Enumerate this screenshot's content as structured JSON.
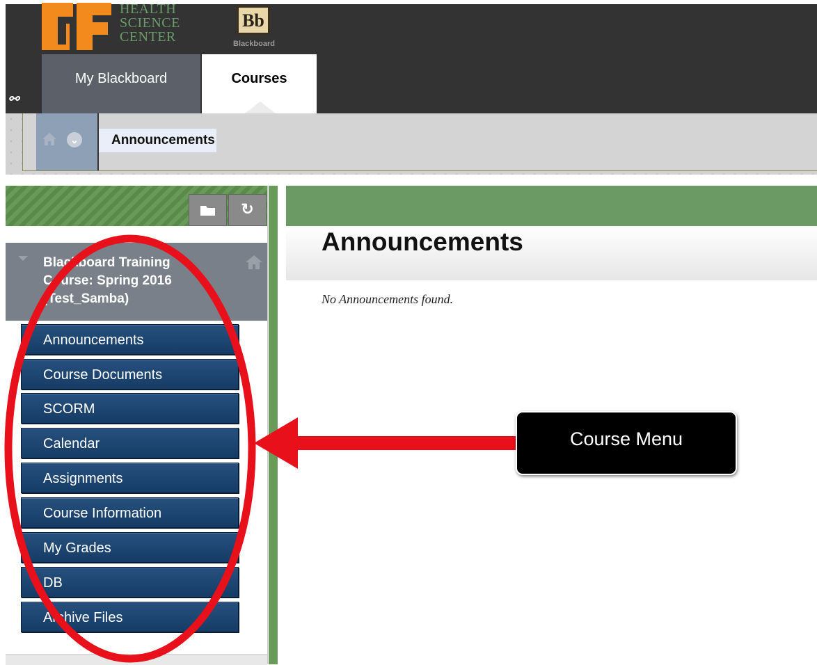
{
  "header": {
    "institution_lines": [
      "HEALTH",
      "SCIENCE",
      "CENTER"
    ],
    "bb_logo_text": "Bb",
    "bb_caption": "Blackboard",
    "tabs": [
      {
        "label": "My Blackboard",
        "active": false
      },
      {
        "label": "Courses",
        "active": true
      }
    ]
  },
  "breadcrumb": {
    "current": "Announcements"
  },
  "course_menu": {
    "course_title": "Blackboard Training Course: Spring 2016 (Test_Samba)",
    "items": [
      {
        "label": "Announcements"
      },
      {
        "label": "Course Documents"
      },
      {
        "label": "SCORM"
      },
      {
        "label": "Calendar"
      },
      {
        "label": "Assignments"
      },
      {
        "label": "Course Information"
      },
      {
        "label": "My Grades"
      },
      {
        "label": "DB"
      },
      {
        "label": "Archive Files"
      }
    ]
  },
  "content": {
    "title": "Announcements",
    "empty_message": "No Announcements found."
  },
  "annotation": {
    "callout_label": "Course Menu",
    "highlight_color": "#e8101a"
  },
  "colors": {
    "header_bg": "#333333",
    "menu_button": "#1d4571",
    "accent_green": "#6b9a64",
    "uf_orange": "#f28a1e"
  }
}
